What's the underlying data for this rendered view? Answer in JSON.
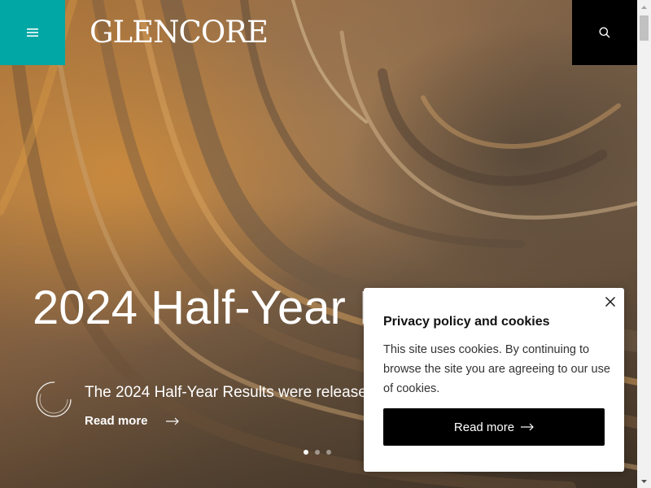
{
  "header": {
    "logo_text": "GLENCORE",
    "menu_icon": "hamburger-icon",
    "search_icon": "search-icon",
    "accent_color": "#00a7a5"
  },
  "hero": {
    "headline": "2024 Half-Year Results",
    "subtitle": "The 2024 Half-Year Results were released",
    "read_more_label": "Read more",
    "slides_total": 3,
    "active_slide": 1
  },
  "cookie_banner": {
    "title": "Privacy policy and cookies",
    "body": "This site uses cookies. By continuing to browse the site you are agreeing to our use of cookies.",
    "button_label": "Read more",
    "close_icon": "close-icon"
  }
}
